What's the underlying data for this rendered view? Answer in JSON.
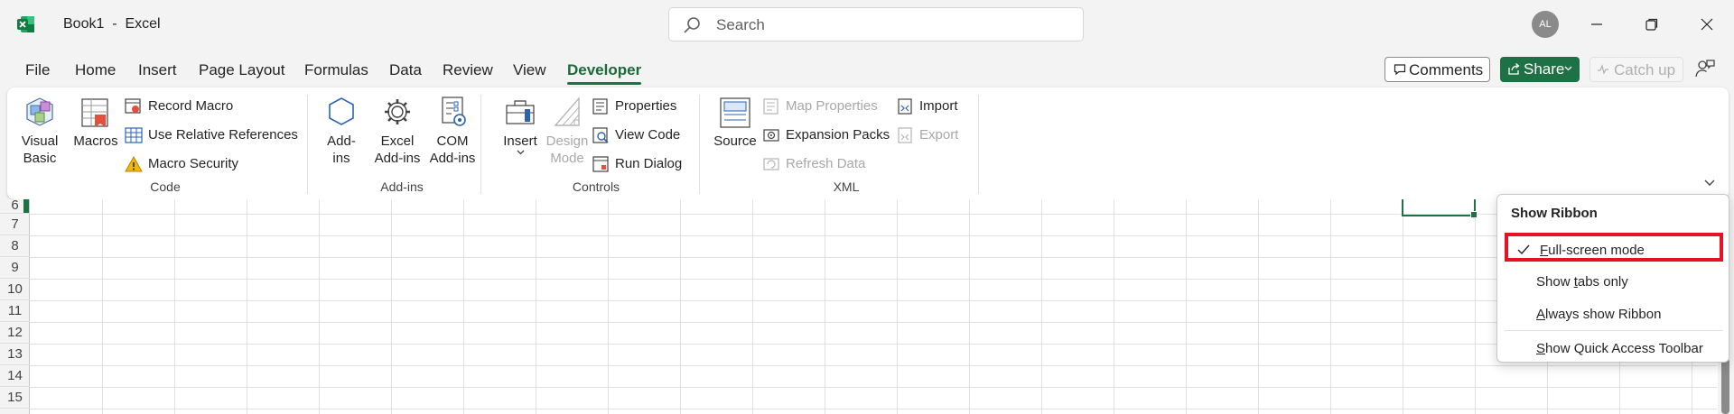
{
  "window": {
    "title": "Book1  -  Excel",
    "search_placeholder": "Search",
    "avatar_initials": "AL"
  },
  "tabs": [
    {
      "label": "File"
    },
    {
      "label": "Home"
    },
    {
      "label": "Insert"
    },
    {
      "label": "Page Layout"
    },
    {
      "label": "Formulas"
    },
    {
      "label": "Data"
    },
    {
      "label": "Review"
    },
    {
      "label": "View"
    },
    {
      "label": "Developer",
      "active": true
    }
  ],
  "actions": {
    "comments": "Comments",
    "share": "Share",
    "catch_up": "Catch up"
  },
  "ribbon": {
    "code": {
      "label": "Code",
      "visual_basic": [
        "Visual",
        "Basic"
      ],
      "macros": "Macros",
      "record_macro": "Record Macro",
      "use_relative_references": "Use Relative References",
      "macro_security": "Macro Security"
    },
    "addins": {
      "label": "Add-ins",
      "addins": [
        "Add-",
        "ins"
      ],
      "excel_addins": [
        "Excel",
        "Add-ins"
      ],
      "com_addins": [
        "COM",
        "Add-ins"
      ]
    },
    "controls": {
      "label": "Controls",
      "insert": "Insert",
      "design_mode": [
        "Design",
        "Mode"
      ],
      "properties": "Properties",
      "view_code": "View Code",
      "run_dialog": "Run Dialog"
    },
    "xml": {
      "label": "XML",
      "source": "Source",
      "map_properties": "Map Properties",
      "expansion_packs": "Expansion Packs",
      "refresh_data": "Refresh Data",
      "import": "Import",
      "export": "Export"
    }
  },
  "grid": {
    "rows": [
      "6",
      "7",
      "8",
      "9",
      "10",
      "11",
      "12",
      "13",
      "14",
      "15"
    ]
  },
  "ribbon_menu": {
    "title": "Show Ribbon",
    "items": [
      {
        "label": "Full-screen mode",
        "accel": "F",
        "rest": "ull-screen mode",
        "checked": true
      },
      {
        "label": "Show tabs only",
        "pre": "Show ",
        "accel": "t",
        "rest": "abs only"
      },
      {
        "label": "Always show Ribbon",
        "accel": "A",
        "rest": "lways show Ribbon"
      },
      {
        "label": "Show Quick Access Toolbar",
        "accel": "S",
        "rest": "how Quick Access Toolbar"
      }
    ]
  },
  "colors": {
    "accent": "#1e7145",
    "highlight_box": "#e81123"
  }
}
